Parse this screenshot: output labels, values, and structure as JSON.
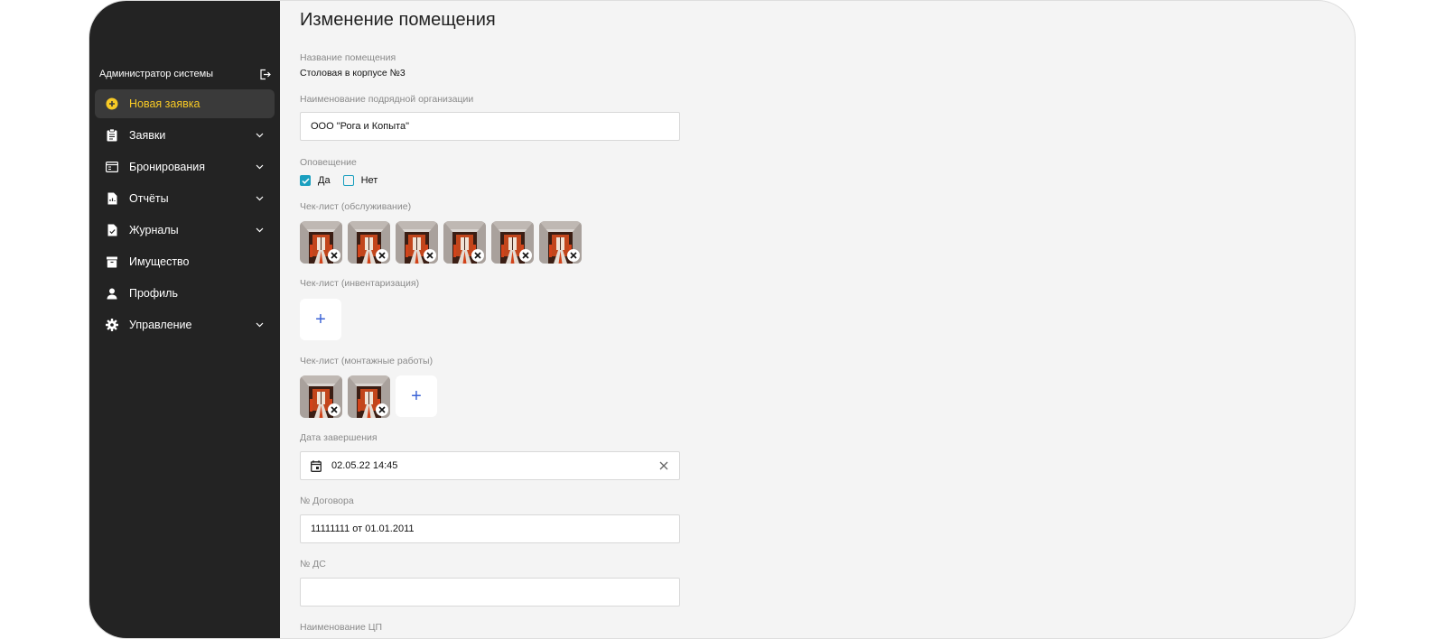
{
  "sidebar": {
    "user_name": "Администратор системы",
    "items": [
      {
        "label": "Новая заявка",
        "icon": "plus-circle-icon",
        "active": true,
        "expandable": false
      },
      {
        "label": "Заявки",
        "icon": "clipboard-icon",
        "active": false,
        "expandable": true
      },
      {
        "label": "Бронирования",
        "icon": "calendar-window-icon",
        "active": false,
        "expandable": true
      },
      {
        "label": "Отчёты",
        "icon": "report-file-icon",
        "active": false,
        "expandable": true
      },
      {
        "label": "Журналы",
        "icon": "journal-file-icon",
        "active": false,
        "expandable": true
      },
      {
        "label": "Имущество",
        "icon": "archive-box-icon",
        "active": false,
        "expandable": false
      },
      {
        "label": "Профиль",
        "icon": "user-icon",
        "active": false,
        "expandable": false
      },
      {
        "label": "Управление",
        "icon": "gear-icon",
        "active": false,
        "expandable": true
      }
    ]
  },
  "main": {
    "title": "Изменение помещения",
    "room_name": {
      "label": "Название помещения",
      "value": "Столовая в корпусе №3"
    },
    "contractor": {
      "label": "Наименование подрядной организации",
      "value": "ООО \"Рога и Копыта\""
    },
    "notification": {
      "label": "Оповещение",
      "yes": "Да",
      "no": "Нет",
      "yes_checked": true,
      "no_checked": false
    },
    "checklist_service": {
      "label": "Чек-лист (обслуживание)",
      "photo_count": 6
    },
    "checklist_inventory": {
      "label": "Чек-лист (инвентаризация)",
      "add": "+"
    },
    "checklist_install": {
      "label": "Чек-лист (монтажные работы)",
      "photo_count": 2,
      "add": "+"
    },
    "end_date": {
      "label": "Дата завершения",
      "value": "02.05.22 14:45"
    },
    "contract": {
      "label": "№ Договора",
      "value": "11111111 от 01.01.2011"
    },
    "ds": {
      "label": "№ ДС",
      "value": ""
    },
    "cp_name": {
      "label": "Наименование ЦП"
    }
  },
  "colors": {
    "sidebar_bg": "#232323",
    "accent_yellow": "#f7c925",
    "checkbox": "#1a9fbf",
    "add_plus": "#3b63d6"
  }
}
